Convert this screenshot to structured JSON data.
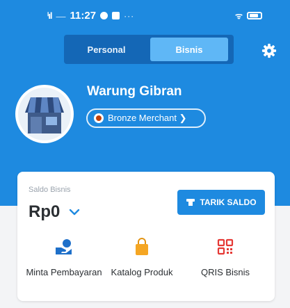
{
  "status_bar": {
    "time": "11:27",
    "signal": "ⁱıl",
    "dash": "—",
    "more": "···",
    "wifi": "ᯤ"
  },
  "segment": {
    "personal": "Personal",
    "bisnis": "Bisnis"
  },
  "profile": {
    "name": "Warung Gibran",
    "badge": "Bronze Merchant ❯"
  },
  "card": {
    "saldo_label": "Saldo Bisnis",
    "saldo_value": "Rp0",
    "tarik_label": "TARIK SALDO"
  },
  "actions": [
    {
      "label": "Minta Pembayaran",
      "icon": "hand-coin-icon"
    },
    {
      "label": "Katalog Produk",
      "icon": "shopping-bag-icon"
    },
    {
      "label": "QRIS Bisnis",
      "icon": "qr-code-icon"
    }
  ],
  "colors": {
    "primary": "#1e8ae0",
    "segment_bg": "#1467b6",
    "segment_active": "#5fb7f6",
    "qris_red": "#e53935",
    "bag_orange": "#f5a623"
  }
}
